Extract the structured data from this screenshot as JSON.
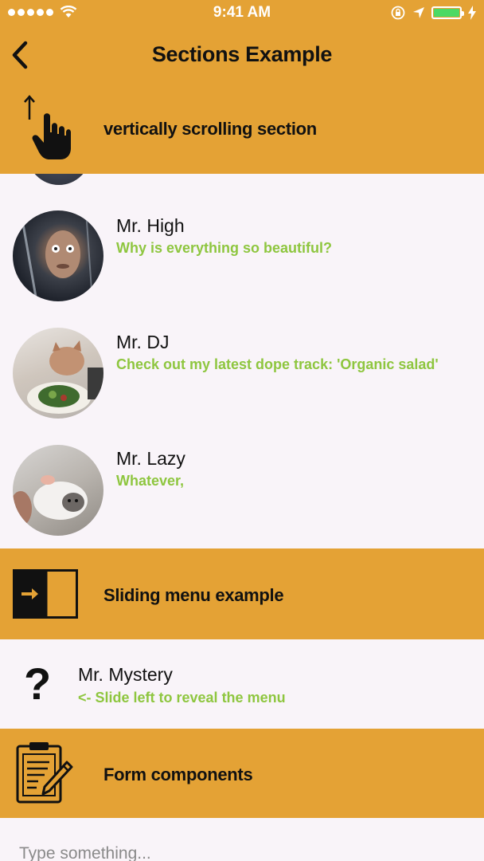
{
  "status_bar": {
    "time": "9:41 AM",
    "signal_icon": "signal-dots-icon",
    "wifi_icon": "wifi-icon",
    "lock_icon": "orientation-lock-icon",
    "location_icon": "location-arrow-icon",
    "battery_icon": "battery-icon",
    "charging_icon": "charging-bolt-icon"
  },
  "nav": {
    "title": "Sections Example",
    "back_icon": "chevron-left-icon"
  },
  "sections": [
    {
      "label": "vertically scrolling section",
      "icon": "scroll-up-hand-icon"
    },
    {
      "label": "Sliding menu example",
      "icon": "sliding-panel-icon"
    },
    {
      "label": "Form components",
      "icon": "clipboard-pen-icon"
    }
  ],
  "contacts": [
    {
      "name": "Mr. High",
      "message": "Why is everything so beautiful?"
    },
    {
      "name": "Mr. DJ",
      "message": "Check out my latest dope track: 'Organic salad'"
    },
    {
      "name": "Mr. Lazy",
      "message": "Whatever,"
    }
  ],
  "mystery": {
    "name": "Mr. Mystery",
    "message": "<- Slide left to reveal the menu",
    "icon": "question-mark-icon"
  },
  "form": {
    "placeholder": "Type something..."
  },
  "colors": {
    "accent": "#e4a235",
    "message_green": "#8ec63f",
    "background": "#f9f4f9",
    "battery_green": "#4cd964"
  }
}
